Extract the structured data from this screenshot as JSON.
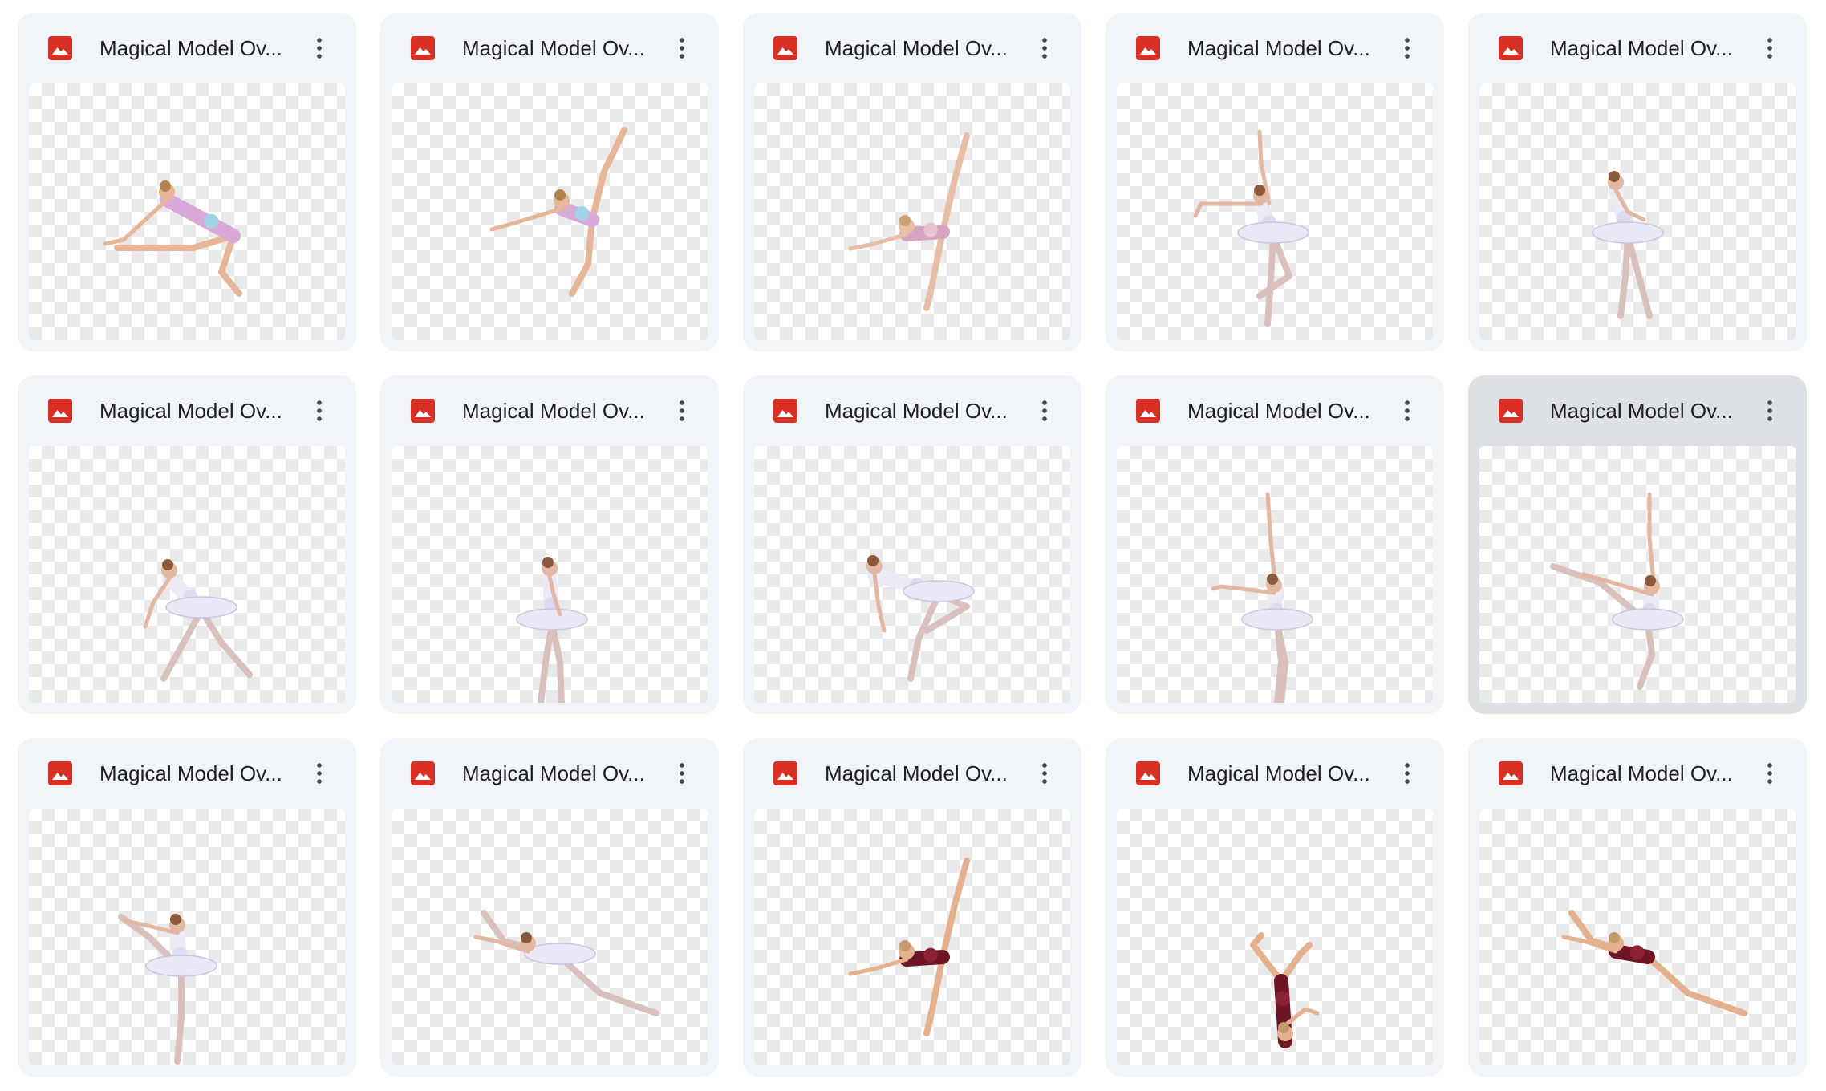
{
  "colors": {
    "card_bg": "#f1f4f9",
    "card_selected_bg": "#dde0e5",
    "image_icon": "#d93025",
    "text": "#1f1f1f"
  },
  "files": [
    {
      "name": "Magical Model Ov...",
      "icon": "image-file-icon",
      "selected": false,
      "pose": "leap-split",
      "costume": "pastel-leotard"
    },
    {
      "name": "Magical Model Ov...",
      "icon": "image-file-icon",
      "selected": false,
      "pose": "leg-hold",
      "costume": "pastel-leotard"
    },
    {
      "name": "Magical Model Ov...",
      "icon": "image-file-icon",
      "selected": false,
      "pose": "needle",
      "costume": "pink-leotard"
    },
    {
      "name": "Magical Model Ov...",
      "icon": "image-file-icon",
      "selected": false,
      "pose": "arabesque-arms",
      "costume": "white-tutu"
    },
    {
      "name": "Magical Model Ov...",
      "icon": "image-file-icon",
      "selected": false,
      "pose": "pointe-standing",
      "costume": "white-tutu"
    },
    {
      "name": "Magical Model Ov...",
      "icon": "image-file-icon",
      "selected": false,
      "pose": "backbend-walk",
      "costume": "white-tutu"
    },
    {
      "name": "Magical Model Ov...",
      "icon": "image-file-icon",
      "selected": false,
      "pose": "standing-back",
      "costume": "white-tutu"
    },
    {
      "name": "Magical Model Ov...",
      "icon": "image-file-icon",
      "selected": false,
      "pose": "bow-forward",
      "costume": "white-tutu"
    },
    {
      "name": "Magical Model Ov...",
      "icon": "image-file-icon",
      "selected": false,
      "pose": "arms-up-front",
      "costume": "white-tutu"
    },
    {
      "name": "Magical Model Ov...",
      "icon": "image-file-icon",
      "selected": true,
      "pose": "kick-side",
      "costume": "white-tutu"
    },
    {
      "name": "Magical Model Ov...",
      "icon": "image-file-icon",
      "selected": false,
      "pose": "leg-hold-high",
      "costume": "white-tutu"
    },
    {
      "name": "Magical Model Ov...",
      "icon": "image-file-icon",
      "selected": false,
      "pose": "split-leap",
      "costume": "white-tutu"
    },
    {
      "name": "Magical Model Ov...",
      "icon": "image-file-icon",
      "selected": false,
      "pose": "needle",
      "costume": "maroon-leotard"
    },
    {
      "name": "Magical Model Ov...",
      "icon": "image-file-icon",
      "selected": false,
      "pose": "scorpion-floor",
      "costume": "maroon-leotard"
    },
    {
      "name": "Magical Model Ov...",
      "icon": "image-file-icon",
      "selected": false,
      "pose": "split-leap",
      "costume": "maroon-leotard"
    }
  ]
}
